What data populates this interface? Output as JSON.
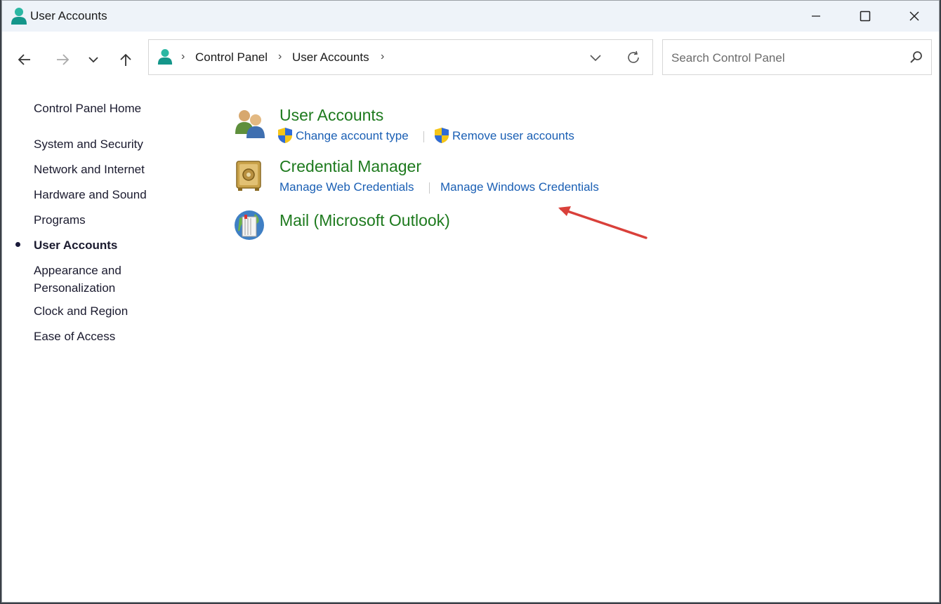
{
  "window": {
    "title": "User Accounts"
  },
  "navigation": {
    "breadcrumb": [
      "Control Panel",
      "User Accounts"
    ],
    "search_placeholder": "Search Control Panel"
  },
  "sidebar": {
    "items": [
      {
        "label": "Control Panel Home"
      },
      {
        "label": "System and Security"
      },
      {
        "label": "Network and Internet"
      },
      {
        "label": "Hardware and Sound"
      },
      {
        "label": "Programs"
      },
      {
        "label": "User Accounts",
        "active": true
      },
      {
        "label": "Appearance and Personalization"
      },
      {
        "label": "Clock and Region"
      },
      {
        "label": "Ease of Access"
      }
    ]
  },
  "categories": [
    {
      "title": "User Accounts",
      "icon": "users-icon",
      "links": [
        "Change account type",
        "Remove user accounts"
      ]
    },
    {
      "title": "Credential Manager",
      "icon": "vault-icon",
      "links": [
        "Manage Web Credentials",
        "Manage Windows Credentials"
      ]
    },
    {
      "title": "Mail (Microsoft Outlook)",
      "icon": "mail-globe-icon",
      "links": []
    }
  ],
  "colors": {
    "category_title": "#1e7a1e",
    "link": "#1a5fb4",
    "annotation_arrow": "#d9403a",
    "titlebar": "#eef3f9"
  }
}
